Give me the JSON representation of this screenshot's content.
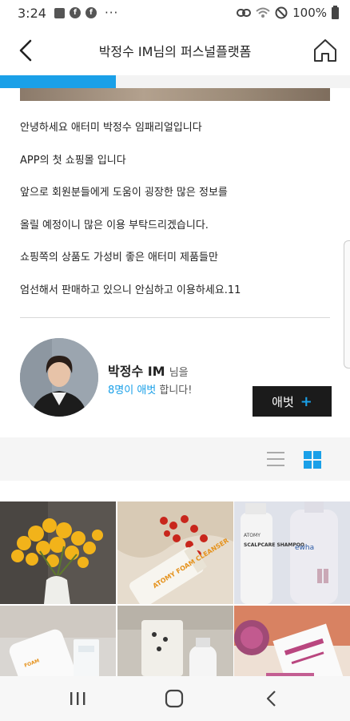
{
  "status_bar": {
    "time": "3:24",
    "battery": "100%"
  },
  "header": {
    "title": "박정수 IM님의 퍼스널플랫폼"
  },
  "progress": {
    "fraction": 0.33
  },
  "intro": {
    "lines": [
      "안녕하세요 애터미 박정수 임패리얼입니다",
      "APP의 첫 쇼핑몰 입니다",
      "앞으로 회원분들에게 도움이 굉장한 많은 정보를",
      "올릴 예정이니 많은 이용 부탁드리겠습니다.",
      "쇼핑쪽의 상품도 가성비 좋은 애터미 제품들만",
      "엄선해서 판매하고 있으니 안심하고 이용하세요.11"
    ]
  },
  "profile": {
    "name": "박정수 IM",
    "name_suffix": "님을",
    "fan_count": "8명이 애벗",
    "fan_suffix": "합니다!",
    "fan_button_label": "애벗",
    "fan_button_plus": "+"
  },
  "grid": {
    "photo_texts": {
      "cleanser": "ATOMY FOAM CLEANSER",
      "shampoo": "SCALPCARE SHAMPOO",
      "shampoo_brand": "ATOMY",
      "ewha": "ewha"
    }
  },
  "colors": {
    "accent": "#1aa0e8",
    "dark_button": "#1b1b1b"
  }
}
